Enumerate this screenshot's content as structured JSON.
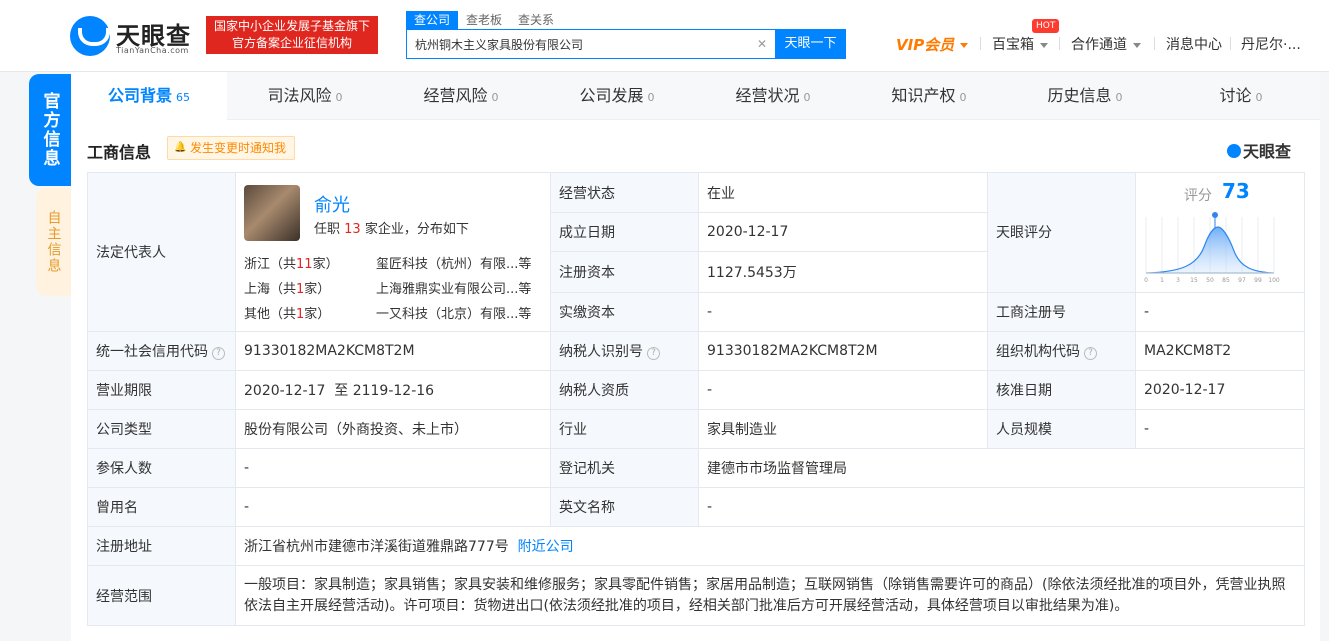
{
  "header": {
    "logo_text": "天眼查",
    "logo_sub": "TianYanCha.com",
    "badge_line1": "国家中小企业发展子基金旗下",
    "badge_line2": "官方备案企业征信机构",
    "search_tabs": [
      "查公司",
      "查老板",
      "查关系"
    ],
    "search_value": "杭州铜木主义家具股份有限公司",
    "search_button": "天眼一下",
    "nav": {
      "vip": "VIP会员",
      "baibaoxiang": "百宝箱",
      "hot": "HOT",
      "hezuo": "合作通道",
      "xiaoxi": "消息中心",
      "user": "丹尼尔·..."
    }
  },
  "side": {
    "official": "官方信息",
    "self": "自主信息"
  },
  "tabs": [
    {
      "label": "公司背景",
      "count": "65"
    },
    {
      "label": "司法风险",
      "count": "0"
    },
    {
      "label": "经营风险",
      "count": "0"
    },
    {
      "label": "公司发展",
      "count": "0"
    },
    {
      "label": "经营状况",
      "count": "0"
    },
    {
      "label": "知识产权",
      "count": "0"
    },
    {
      "label": "历史信息",
      "count": "0"
    },
    {
      "label": "讨论",
      "count": "0"
    }
  ],
  "section": {
    "title": "工商信息",
    "notify": "发生变更时通知我",
    "brand": "天眼查"
  },
  "info": {
    "legal_rep_label": "法定代表人",
    "rep_name": "俞光",
    "rep_desc_pre": "任职",
    "rep_desc_num": "13",
    "rep_desc_post": "家企业，分布如下",
    "rep_regions": [
      {
        "pre": "浙江（共",
        "num": "11",
        "post": "家）",
        "company": "玺匠科技（杭州）有限...等"
      },
      {
        "pre": "上海（共",
        "num": "1",
        "post": "家）",
        "company": "上海雅鼎实业有限公司...等"
      },
      {
        "pre": "其他（共",
        "num": "1",
        "post": "家）",
        "company": "一又科技（北京）有限...等"
      }
    ],
    "status_label": "经营状态",
    "status": "在业",
    "found_label": "成立日期",
    "found": "2020-12-17",
    "reg_cap_label": "注册资本",
    "reg_cap": "1127.5453万",
    "paid_cap_label": "实缴资本",
    "paid_cap": "-",
    "tyscore_label": "天眼评分",
    "score_label": "评分",
    "score": "73",
    "score_ticks": [
      "0",
      "1",
      "3",
      "15",
      "50",
      "85",
      "97",
      "99",
      "100"
    ],
    "reg_no_label": "工商注册号",
    "reg_no": "-",
    "credit_label": "统一社会信用代码",
    "credit": "91330182MA2KCM8T2M",
    "tax_label": "纳税人识别号",
    "tax": "91330182MA2KCM8T2M",
    "org_label": "组织机构代码",
    "org": "MA2KCM8T2",
    "term_label": "营业期限",
    "term": "2020-12-17  至 2119-12-16",
    "taxpayer_q_label": "纳税人资质",
    "taxpayer_q": "-",
    "approve_label": "核准日期",
    "approve": "2020-12-17",
    "type_label": "公司类型",
    "type": "股份有限公司（外商投资、未上市）",
    "industry_label": "行业",
    "industry": "家具制造业",
    "staff_label": "人员规模",
    "staff": "-",
    "insured_label": "参保人数",
    "insured": "-",
    "authority_label": "登记机关",
    "authority": "建德市市场监督管理局",
    "former_label": "曾用名",
    "former": "-",
    "en_label": "英文名称",
    "en": "-",
    "addr_label": "注册地址",
    "addr": "浙江省杭州市建德市洋溪街道雅鼎路777号",
    "addr_link": "附近公司",
    "scope_label": "经营范围",
    "scope": "一般项目：家具制造；家具销售；家具安装和维修服务；家具零配件销售；家居用品制造；互联网销售（除销售需要许可的商品）(除依法须经批准的项目外，凭营业执照依法自主开展经营活动)。许可项目：货物进出口(依法须经批准的项目，经相关部门批准后方可开展经营活动，具体经营项目以审批结果为准)。"
  },
  "colors": {
    "accent": "#0084ff",
    "red": "#e0271f",
    "orange": "#ff7a00"
  }
}
